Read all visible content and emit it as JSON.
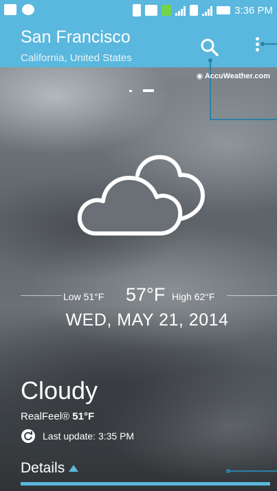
{
  "status_bar": {
    "time": "3:36 PM"
  },
  "app_bar": {
    "city": "San Francisco",
    "region": "California, United States"
  },
  "provider": "AccuWeather.com",
  "weather": {
    "low": "Low 51°F",
    "current": "57°F",
    "high": "High 62°F",
    "date": "WED, MAY 21, 2014",
    "condition": "Cloudy",
    "realfeel_label": "RealFeel®",
    "realfeel_value": "51°F",
    "last_update": "Last update: 3:35 PM"
  },
  "details_label": "Details",
  "colors": {
    "accent": "#5ab7dd",
    "callout": "#2d7fa8"
  },
  "icons": [
    "search-icon",
    "overflow-menu-icon",
    "cloudy-icon",
    "refresh-icon",
    "expand-arrow-icon"
  ]
}
